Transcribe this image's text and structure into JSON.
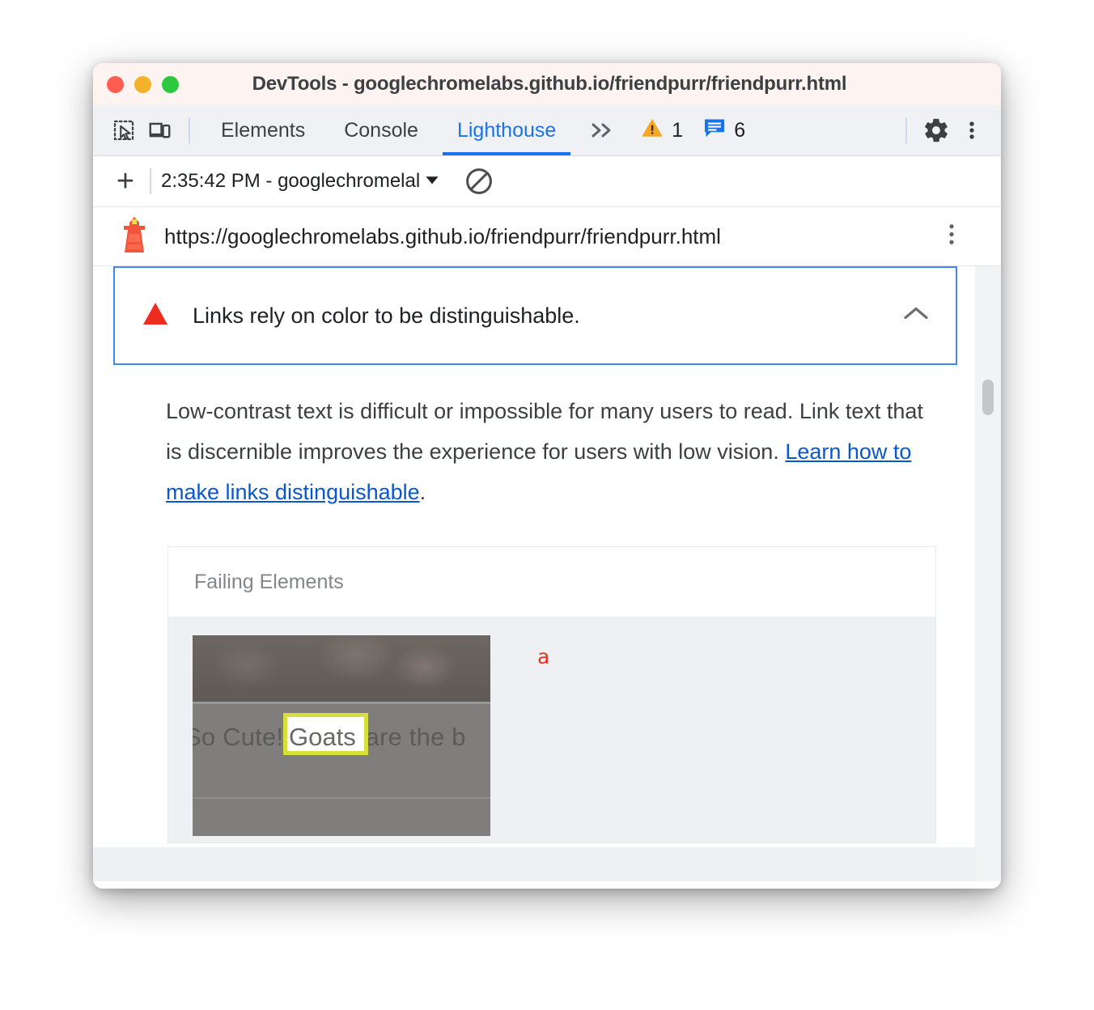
{
  "window": {
    "title": "DevTools - googlechromelabs.github.io/friendpurr/friendpurr.html",
    "traffic_lights": [
      {
        "name": "close",
        "color": "#ff5f52"
      },
      {
        "name": "minimize",
        "color": "#f3b229"
      },
      {
        "name": "maximize",
        "color": "#2bc840"
      }
    ]
  },
  "toolbar": {
    "inspect_icon": "inspect-element-icon",
    "device_icon": "device-toolbar-icon",
    "tabs": [
      {
        "label": "Elements",
        "active": false
      },
      {
        "label": "Console",
        "active": false
      },
      {
        "label": "Lighthouse",
        "active": true
      }
    ],
    "more_tabs_label": "»",
    "warning_count": "1",
    "message_count": "6",
    "settings_icon": "gear-icon",
    "menu_icon": "kebab-menu-icon"
  },
  "lighthouse_toolbar": {
    "add_label": "+",
    "run_selected": "2:35:42 PM - googlechromelal",
    "dropdown_caret": "▾",
    "clear_icon": "clear-all-icon"
  },
  "report_header": {
    "logo_icon": "lighthouse-icon",
    "url": "https://googlechromelabs.github.io/friendpurr/friendpurr.html",
    "menu_icon": "kebab-menu-icon"
  },
  "audit": {
    "severity_icon": "red-triangle-fail-icon",
    "title": "Links rely on color to be distinguishable.",
    "collapse_icon": "chevron-up-icon",
    "description_part1": "Low-contrast text is difficult or impossible for many users to read. Link text that is discernible improves the experience for users with low vision. ",
    "description_link": "Learn how to make links distinguishable",
    "description_part2": ".",
    "table": {
      "header": "Failing Elements",
      "rows": [
        {
          "thumbnail_text_before": "So Cute! ",
          "thumbnail_highlight": "Goats",
          "thumbnail_text_after": " are the b",
          "snippet": "a"
        }
      ]
    }
  },
  "scrollbar": {
    "name": "report-vertical-scrollbar"
  },
  "colors": {
    "accent_blue": "#1a73e8",
    "link_blue": "#0b57d0",
    "fail_red": "#e8321b",
    "warn_orange": "#f5a623",
    "highlight_yellow": "#d7e03a",
    "titlebar_bg": "#fdf3f0",
    "tabstrip_bg": "#eff1f5"
  }
}
